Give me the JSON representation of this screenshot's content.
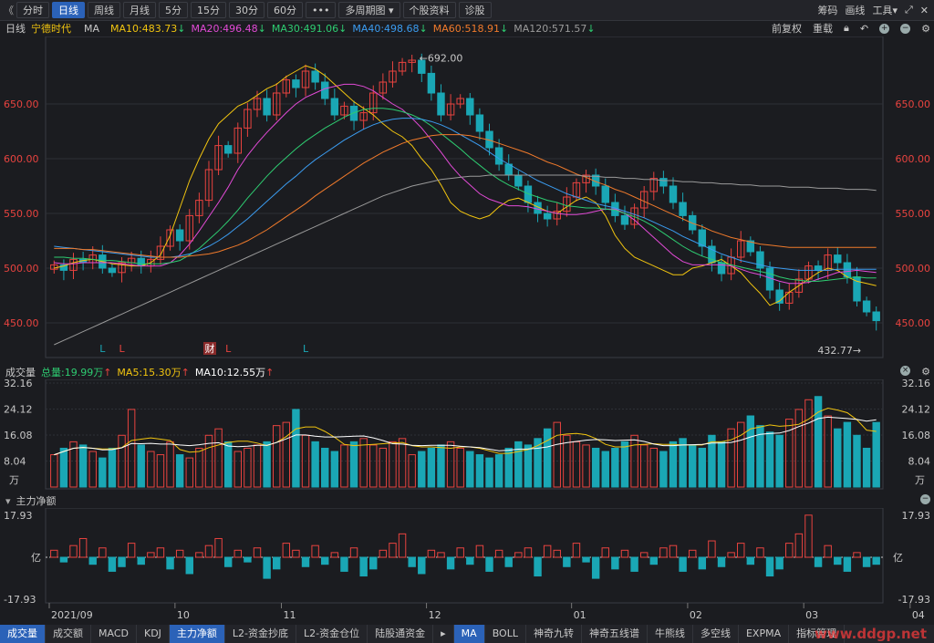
{
  "toolbar": {
    "back_glyph": "《",
    "periods": [
      "分时",
      "日线",
      "周线",
      "月线",
      "5分",
      "15分",
      "30分",
      "60分"
    ],
    "active_period": "日线",
    "more_label": "•••",
    "multi_period": "多周期图",
    "stock_info": "个股资料",
    "diagnose": "诊股",
    "right_items": [
      "筹码",
      "画线",
      "工具"
    ]
  },
  "legend": {
    "period": "日线",
    "stock_name": "宁德时代",
    "ma_label": "MA",
    "ma10": "MA10:483.73",
    "ma20": "MA20:496.48",
    "ma30": "MA30:491.06",
    "ma40": "MA40:498.68",
    "ma60": "MA60:518.91",
    "ma120": "MA120:571.57",
    "fuquan": "前复权",
    "overlay": "重载"
  },
  "volume_header": {
    "title": "成交量",
    "total": "总量:19.99万",
    "ma5": "MA5:15.30万",
    "ma10": "MA10:12.55万"
  },
  "flow_header": {
    "title": "主力净额"
  },
  "colors": {
    "up": "#e8433f",
    "down": "#1aa7b5",
    "ma10": "#f1c40f",
    "ma20": "#e24ad6",
    "ma30": "#2ecc71",
    "ma40": "#3b9cf0",
    "ma60": "#f07a2b",
    "ma120": "#9a9a9a"
  },
  "chart_data": [
    {
      "type": "candlestick",
      "y_ticks": [
        "650.00",
        "600.00",
        "550.00",
        "500.00",
        "450.00"
      ],
      "ylim": [
        420,
        705
      ],
      "max_label": "692.00",
      "min_label": "432.77",
      "x_ticks": [
        "2021/09",
        "10",
        "11",
        "12",
        "01",
        "02",
        "03",
        "04"
      ],
      "markers": [
        "L",
        "L",
        "财",
        "L",
        "L"
      ],
      "series": [
        {
          "name": "MA10",
          "values": [
            500,
            502,
            505,
            507,
            508,
            506,
            504,
            503,
            502,
            502,
            505,
            512,
            530,
            555,
            580,
            600,
            618,
            632,
            640,
            648,
            652,
            658,
            664,
            668,
            675,
            680,
            685,
            682,
            676,
            668,
            660,
            652,
            646,
            640,
            632,
            625,
            620,
            612,
            600,
            590,
            576,
            560,
            552,
            548,
            545,
            548,
            556,
            562,
            564,
            560,
            556,
            552,
            550,
            556,
            562,
            565,
            560,
            548,
            530,
            518,
            510,
            506,
            502,
            498,
            494,
            494,
            500,
            502,
            505,
            508,
            502,
            496,
            486,
            477,
            466,
            470,
            478,
            484,
            490,
            496,
            500,
            498,
            492,
            488,
            486,
            484
          ]
        },
        {
          "name": "MA20",
          "values": [
            505,
            504,
            504,
            505,
            505,
            505,
            505,
            504,
            503,
            502,
            502,
            502,
            505,
            512,
            522,
            534,
            547,
            560,
            574,
            590,
            603,
            614,
            624,
            633,
            642,
            650,
            656,
            660,
            664,
            666,
            668,
            668,
            666,
            662,
            656,
            650,
            645,
            637,
            628,
            617,
            606,
            594,
            584,
            576,
            568,
            563,
            560,
            557,
            557,
            556,
            554,
            552,
            550,
            549,
            549,
            550,
            552,
            554,
            554,
            550,
            544,
            536,
            528,
            520,
            512,
            506,
            503,
            503,
            503,
            503,
            502,
            499,
            496,
            494,
            491,
            488,
            486,
            486,
            487,
            490,
            493,
            496,
            497,
            498,
            497,
            496
          ]
        },
        {
          "name": "MA30",
          "values": [
            510,
            510,
            509,
            509,
            508,
            507,
            507,
            506,
            505,
            504,
            504,
            504,
            505,
            507,
            512,
            518,
            526,
            534,
            543,
            553,
            564,
            574,
            584,
            593,
            601,
            609,
            616,
            622,
            628,
            633,
            638,
            642,
            645,
            646,
            646,
            645,
            643,
            640,
            636,
            630,
            623,
            616,
            609,
            601,
            594,
            587,
            581,
            576,
            572,
            568,
            565,
            562,
            560,
            557,
            556,
            555,
            555,
            554,
            553,
            550,
            547,
            543,
            538,
            532,
            526,
            520,
            515,
            511,
            508,
            505,
            503,
            501,
            499,
            497,
            495,
            492,
            490,
            489,
            488,
            488,
            489,
            490,
            491,
            492,
            491,
            491
          ]
        },
        {
          "name": "MA40",
          "values": [
            520,
            519,
            518,
            517,
            516,
            515,
            514,
            513,
            512,
            511,
            510,
            510,
            510,
            511,
            513,
            516,
            520,
            525,
            531,
            538,
            545,
            553,
            561,
            569,
            577,
            584,
            592,
            599,
            605,
            611,
            617,
            622,
            627,
            631,
            634,
            636,
            637,
            637,
            636,
            634,
            631,
            627,
            622,
            617,
            612,
            606,
            600,
            595,
            590,
            585,
            580,
            576,
            572,
            568,
            565,
            562,
            559,
            557,
            555,
            552,
            549,
            546,
            542,
            538,
            534,
            529,
            525,
            521,
            517,
            513,
            510,
            507,
            505,
            503,
            501,
            500,
            499,
            498,
            498,
            498,
            498,
            499,
            499,
            499,
            499,
            499
          ]
        },
        {
          "name": "MA60",
          "values": [
            518,
            518,
            518,
            517,
            517,
            516,
            515,
            514,
            513,
            512,
            511,
            510,
            510,
            510,
            511,
            512,
            513,
            515,
            518,
            521,
            525,
            530,
            535,
            541,
            547,
            553,
            559,
            566,
            572,
            578,
            584,
            590,
            596,
            601,
            606,
            610,
            614,
            617,
            619,
            621,
            622,
            622,
            622,
            621,
            619,
            617,
            614,
            611,
            608,
            605,
            601,
            597,
            594,
            590,
            586,
            583,
            579,
            576,
            572,
            569,
            565,
            561,
            557,
            553,
            549,
            545,
            541,
            538,
            534,
            531,
            528,
            526,
            524,
            522,
            521,
            520,
            519,
            519,
            519,
            519,
            519,
            519,
            519,
            519,
            519,
            519
          ]
        },
        {
          "name": "MA120",
          "values": [
            430,
            434,
            438,
            442,
            446,
            450,
            454,
            458,
            462,
            466,
            470,
            474,
            478,
            482,
            486,
            490,
            494,
            498,
            502,
            506,
            510,
            514,
            518,
            522,
            526,
            530,
            534,
            538,
            542,
            546,
            550,
            554,
            558,
            562,
            566,
            569,
            572,
            575,
            577,
            579,
            581,
            582,
            583,
            584,
            584,
            585,
            585,
            585,
            585,
            585,
            585,
            585,
            585,
            585,
            585,
            584,
            584,
            583,
            583,
            582,
            582,
            581,
            581,
            580,
            580,
            579,
            579,
            578,
            578,
            577,
            577,
            576,
            576,
            575,
            575,
            575,
            574,
            574,
            574,
            573,
            573,
            573,
            572,
            572,
            572,
            571
          ]
        }
      ],
      "candles_close": [
        503,
        498,
        508,
        505,
        512,
        500,
        496,
        505,
        509,
        502,
        508,
        520,
        535,
        525,
        548,
        562,
        590,
        612,
        605,
        628,
        645,
        655,
        640,
        660,
        672,
        665,
        680,
        670,
        655,
        640,
        648,
        635,
        642,
        660,
        670,
        680,
        688,
        690,
        678,
        660,
        640,
        650,
        655,
        640,
        625,
        610,
        595,
        585,
        575,
        560,
        550,
        545,
        552,
        565,
        578,
        585,
        575,
        560,
        548,
        540,
        555,
        570,
        582,
        575,
        560,
        548,
        535,
        520,
        505,
        495,
        510,
        525,
        515,
        500,
        480,
        468,
        478,
        490,
        502,
        498,
        512,
        505,
        492,
        470,
        460,
        452
      ]
    },
    {
      "type": "bar",
      "name": "成交量",
      "y_ticks": [
        "32.16",
        "24.12",
        "16.08",
        "8.04"
      ],
      "unit": "万",
      "ylim": [
        0,
        32.16
      ],
      "values": [
        10,
        12,
        14,
        13,
        11,
        9,
        12,
        16,
        24,
        13,
        11,
        10,
        14,
        10,
        9,
        12,
        16,
        18,
        14,
        11,
        12,
        13,
        14,
        19,
        20,
        24,
        16,
        14,
        12,
        11,
        13,
        14,
        15,
        13,
        12,
        14,
        15,
        10,
        11,
        12,
        13,
        14,
        12,
        11,
        10,
        9,
        10,
        12,
        14,
        13,
        15,
        18,
        20,
        16,
        14,
        13,
        12,
        11,
        12,
        14,
        16,
        13,
        12,
        11,
        14,
        15,
        13,
        12,
        16,
        14,
        18,
        20,
        22,
        19,
        17,
        16,
        21,
        24,
        27,
        28,
        22,
        18,
        20,
        16,
        12,
        19.99
      ]
    },
    {
      "type": "bar",
      "name": "主力净额",
      "y_ticks": [
        "17.93",
        "-17.93"
      ],
      "unit": "亿",
      "ylim": [
        -17.93,
        17.93
      ],
      "values": [
        3,
        -2,
        5,
        8,
        -3,
        4,
        -6,
        -4,
        6,
        -3,
        2,
        4,
        -5,
        3,
        -7,
        2,
        5,
        8,
        -4,
        3,
        -2,
        4,
        -9,
        -5,
        6,
        3,
        -4,
        5,
        -3,
        2,
        -6,
        4,
        -8,
        -5,
        3,
        6,
        10,
        -4,
        -7,
        3,
        2,
        -5,
        4,
        -3,
        5,
        -6,
        3,
        -4,
        2,
        4,
        -8,
        5,
        3,
        -4,
        6,
        -2,
        -9,
        4,
        -5,
        3,
        -6,
        2,
        -3,
        4,
        5,
        -6,
        3,
        -5,
        7,
        -4,
        2,
        6,
        -3,
        4,
        -8,
        -5,
        6,
        10,
        18,
        -4,
        5,
        -3,
        -6,
        2,
        -4,
        -3
      ]
    }
  ],
  "bottom_tabs": [
    "成交量",
    "成交额",
    "MACD",
    "KDJ",
    "主力净额",
    "L2-资金抄底",
    "L2-资金仓位",
    "陆股通资金",
    "MA",
    "BOLL",
    "神奇九转",
    "神奇五线谱",
    "牛熊线",
    "多空线",
    "EXPMA",
    "指标管理"
  ],
  "active_bottom_tabs": [
    "成交量",
    "主力净额",
    "MA"
  ],
  "watermark": "www.ddgp.net"
}
